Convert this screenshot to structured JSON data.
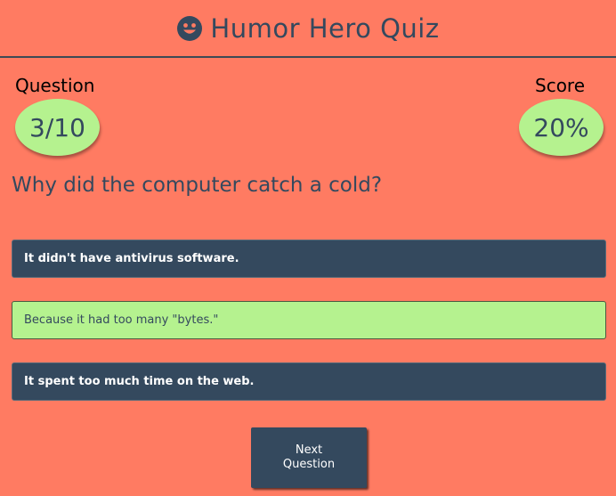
{
  "header": {
    "title": "Humor Hero Quiz",
    "icon": "smiley-face-icon"
  },
  "question_counter": {
    "label": "Question",
    "value": "3/10"
  },
  "score": {
    "label": "Score",
    "value": "20%"
  },
  "question": {
    "text": "Why did the computer catch a cold?"
  },
  "answers": [
    {
      "text": "It didn't have antivirus software.",
      "state": "default"
    },
    {
      "text": "Because it had too many \"bytes.\"",
      "state": "correct"
    },
    {
      "text": "It spent too much time on the web.",
      "state": "default"
    }
  ],
  "next_button": {
    "line1": "Next",
    "line2": "Question"
  },
  "colors": {
    "background": "#ff7b62",
    "primary": "#34495e",
    "correct": "#b5f28f"
  }
}
